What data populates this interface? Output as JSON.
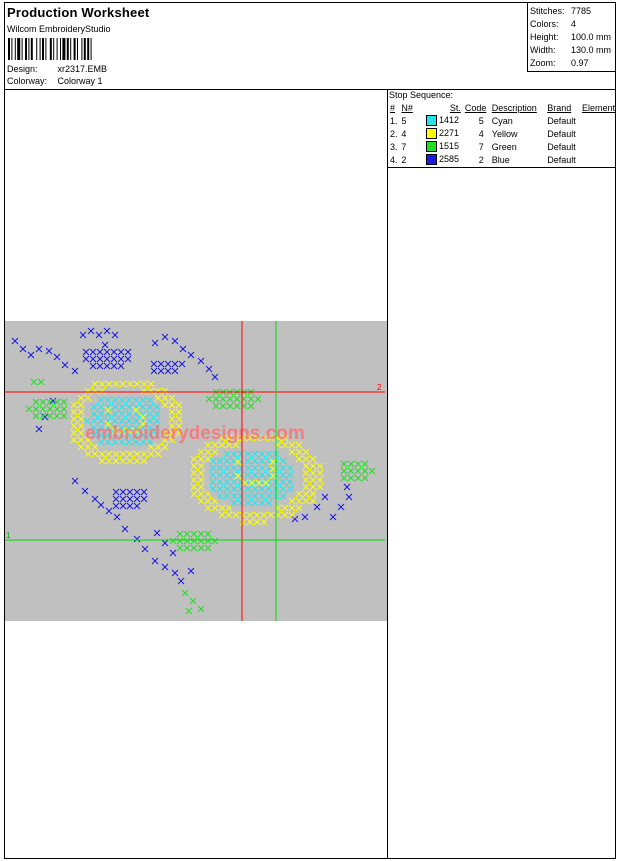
{
  "header": {
    "title": "Production Worksheet",
    "subtitle": "Wilcom EmbroideryStudio",
    "design_label": "Design:",
    "design_value": "xr2317.EMB",
    "colorway_label": "Colorway:",
    "colorway_value": "Colorway 1"
  },
  "stats": [
    {
      "label": "Stitches:",
      "value": "7785"
    },
    {
      "label": "Colors:",
      "value": "4"
    },
    {
      "label": "Height:",
      "value": "100.0 mm"
    },
    {
      "label": "Width:",
      "value": "130.0 mm"
    },
    {
      "label": "Zoom:",
      "value": "0.97"
    }
  ],
  "stop_sequence": {
    "title": "Stop Sequence:",
    "headers": [
      "#",
      "N#",
      "St.",
      "Code",
      "Description",
      "Brand",
      "Element"
    ],
    "rows": [
      {
        "num": "1.",
        "n": "5",
        "color": "#22e4ef",
        "stitches": "1412",
        "code": "5",
        "description": "Cyan",
        "brand": "Default"
      },
      {
        "num": "2.",
        "n": "4",
        "color": "#ffff00",
        "stitches": "2271",
        "code": "4",
        "description": "Yellow",
        "brand": "Default"
      },
      {
        "num": "3.",
        "n": "7",
        "color": "#22dd22",
        "stitches": "1515",
        "code": "7",
        "description": "Green",
        "brand": "Default"
      },
      {
        "num": "4.",
        "n": "2",
        "color": "#1a1ae0",
        "stitches": "2585",
        "code": "2",
        "description": "Blue",
        "brand": "Default"
      }
    ]
  },
  "design": {
    "watermark": "embroiderydesigns.com",
    "marker_2": "2",
    "marker_1": "1",
    "background": "#c0c0c0",
    "crosshair_red": "#ff0000",
    "crosshair_green": "#00dd00"
  }
}
